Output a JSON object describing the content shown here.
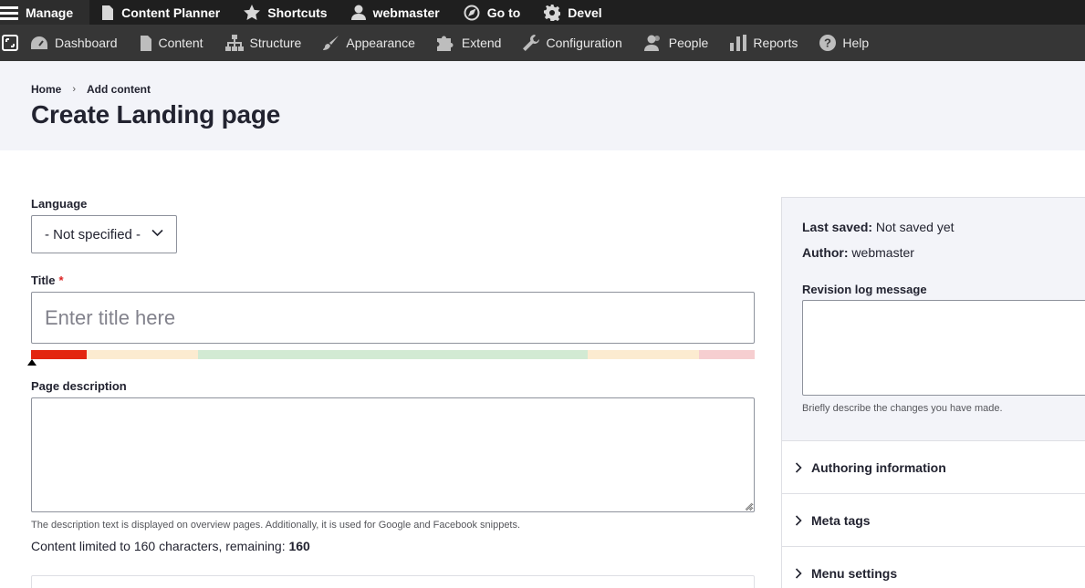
{
  "toolbar": {
    "manage": "Manage",
    "content_planner": "Content Planner",
    "shortcuts": "Shortcuts",
    "user": "webmaster",
    "goto": "Go to",
    "devel": "Devel"
  },
  "admin_menu": {
    "dashboard": "Dashboard",
    "content": "Content",
    "structure": "Structure",
    "appearance": "Appearance",
    "extend": "Extend",
    "configuration": "Configuration",
    "people": "People",
    "reports": "Reports",
    "help": "Help"
  },
  "breadcrumb": {
    "home": "Home",
    "separator": "›",
    "add_content": "Add content"
  },
  "page_title": "Create Landing page",
  "form": {
    "language_label": "Language",
    "language_value": "- Not specified -",
    "title_label": "Title",
    "title_required": "*",
    "title_placeholder": "Enter title here",
    "page_description_label": "Page description",
    "description_help": "The description text is displayed on overview pages. Additionally, it is used for Google and Facebook snippets.",
    "limit_text": "Content limited to 160 characters, remaining: ",
    "limit_remaining": "160"
  },
  "sidebar": {
    "last_saved_label": "Last saved:",
    "last_saved_value": " Not saved yet",
    "author_label": "Author:",
    "author_value": " webmaster",
    "revision_label": "Revision log message",
    "revision_help": "Briefly describe the changes you have made.",
    "authoring_info": "Authoring information",
    "meta_tags": "Meta tags",
    "menu_settings": "Menu settings"
  },
  "colors": {
    "toolbar_bg": "#1f1f1f",
    "tray_bg": "#363636",
    "header_bg": "#f3f4f9",
    "meter_red": "#e3260f",
    "meter_orange_light": "#fcebd0",
    "meter_green_light": "#d2ead3",
    "meter_red_light": "#f6ced0"
  }
}
